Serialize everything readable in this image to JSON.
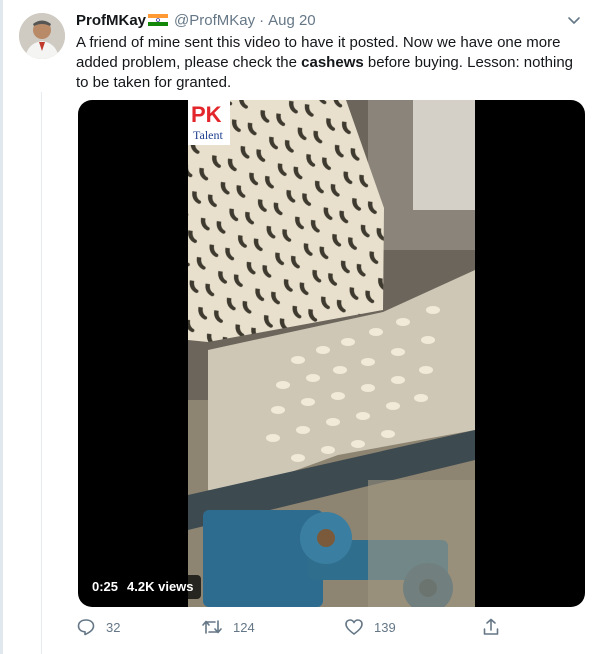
{
  "tweet": {
    "author_name": "ProfMKay",
    "author_handle": "@ProfMKay",
    "separator": "·",
    "date": "Aug 20",
    "text_part1": "A friend of mine sent this video to have it posted. Now we have one more added problem, please check the ",
    "text_bold": "cashews",
    "text_part2": " before buying. Lesson: nothing to be taken for granted."
  },
  "video": {
    "duration": "0:25",
    "views": "4.2K views",
    "watermark_top": "PK",
    "watermark_bottom": "Talent"
  },
  "actions": {
    "reply_count": "32",
    "retweet_count": "124",
    "like_count": "139"
  },
  "icons": {
    "flag": "india-flag-icon",
    "menu": "chevron-down-icon",
    "reply": "reply-icon",
    "retweet": "retweet-icon",
    "like": "heart-icon",
    "share": "share-icon"
  },
  "colors": {
    "text_primary": "#14171a",
    "text_secondary": "#657786",
    "media_background": "#000000",
    "flag_saffron": "#ff9933",
    "flag_green": "#138808",
    "watermark_red": "#e3262b",
    "watermark_blue": "#1f3f8e"
  }
}
